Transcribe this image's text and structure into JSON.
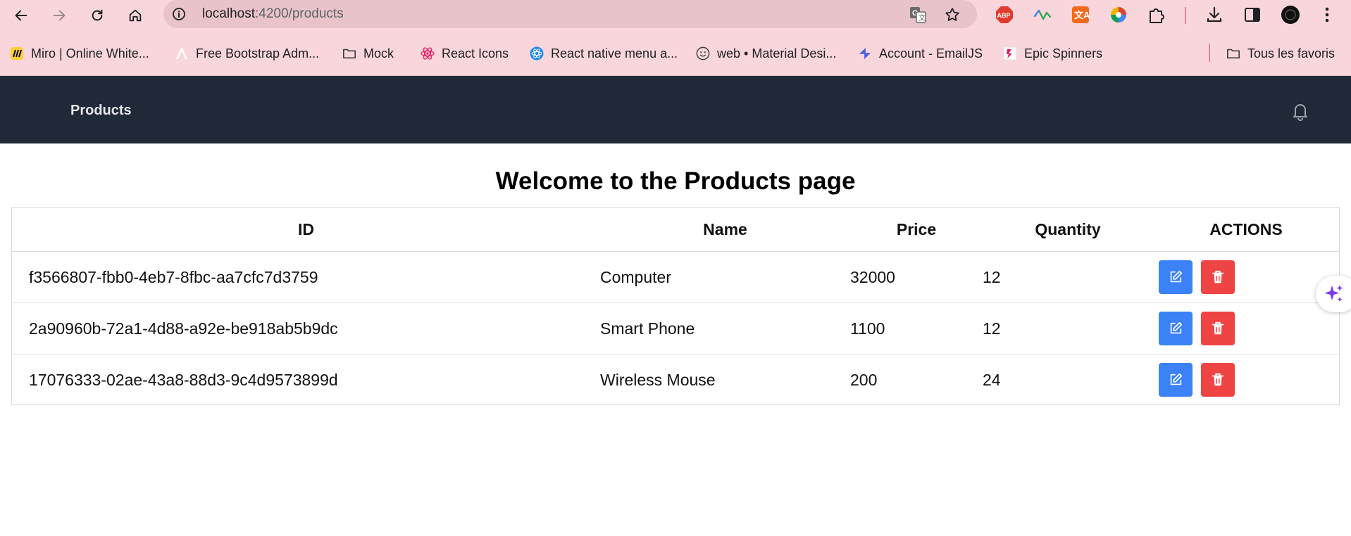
{
  "browser": {
    "url_host": "localhost",
    "url_path": ":4200/products",
    "colors": {
      "chrome_bg": "#f9d6dc",
      "omnibox_bg": "#e8c3c9"
    }
  },
  "bookmarks": [
    {
      "label": "Miro | Online White...",
      "icon": "miro-icon"
    },
    {
      "label": "Free Bootstrap Adm...",
      "icon": "adminlte-icon"
    },
    {
      "label": "Mock",
      "icon": "folder-icon"
    },
    {
      "label": "React Icons",
      "icon": "react-icon"
    },
    {
      "label": "React native menu a...",
      "icon": "react-native-icon"
    },
    {
      "label": "web • Material Desi...",
      "icon": "smiley-icon"
    },
    {
      "label": "Account - EmailJS",
      "icon": "emailjs-icon"
    },
    {
      "label": "Epic Spinners",
      "icon": "epic-spinners-icon"
    },
    {
      "label": "Tous les favoris",
      "icon": "folder-icon"
    }
  ],
  "app": {
    "nav_title": "Products",
    "colors": {
      "nav_bg": "#1f2937",
      "edit": "#3b82f6",
      "delete": "#ef4444"
    }
  },
  "page": {
    "heading": "Welcome to the Products page",
    "columns": [
      "ID",
      "Name",
      "Price",
      "Quantity",
      "ACTIONS"
    ],
    "rows": [
      {
        "id": "f3566807-fbb0-4eb7-8fbc-aa7cfc7d3759",
        "name": "Computer",
        "price": "32000",
        "quantity": "12"
      },
      {
        "id": "2a90960b-72a1-4d88-a92e-be918ab5b9dc",
        "name": "Smart Phone",
        "price": "1100",
        "quantity": "12"
      },
      {
        "id": "17076333-02ae-43a8-88d3-9c4d9573899d",
        "name": "Wireless Mouse",
        "price": "200",
        "quantity": "24"
      }
    ]
  }
}
